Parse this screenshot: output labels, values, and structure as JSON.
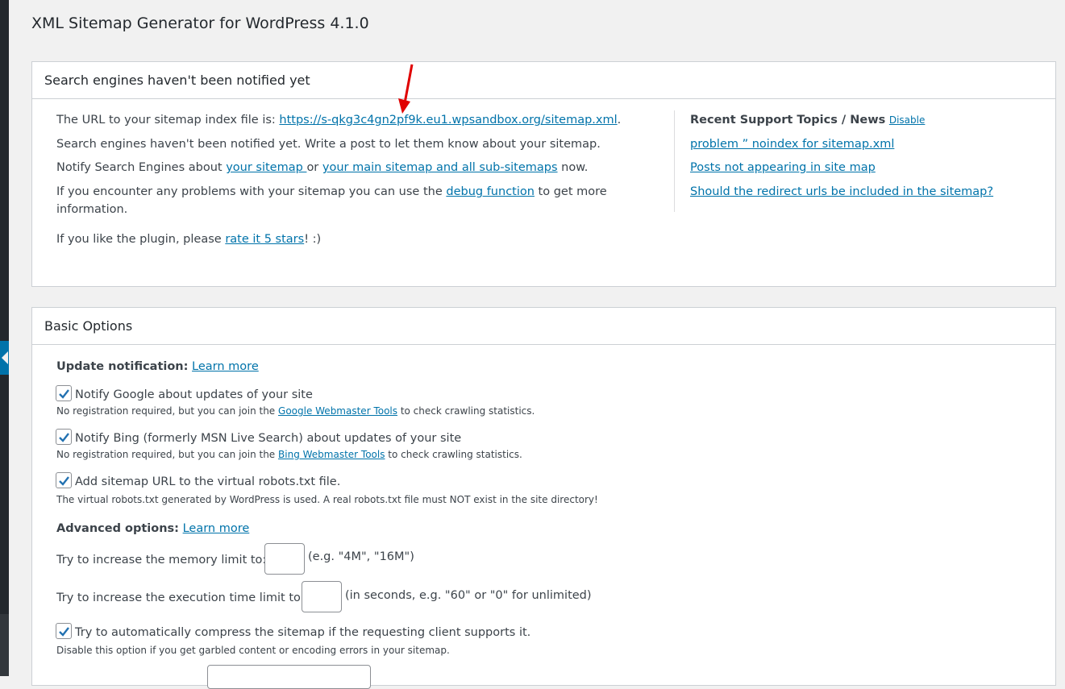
{
  "page": {
    "title": "XML Sitemap Generator for WordPress 4.1.0"
  },
  "status_box": {
    "title": "Search engines haven't been notified yet",
    "url_prefix": "The URL to your sitemap index file is: ",
    "url_link": "https://s-qkg3c4gn2pf9k.eu1.wpsandbox.org/sitemap.xml",
    "url_suffix": ".",
    "not_notified": "Search engines haven't been notified yet. Write a post to let them know about your sitemap.",
    "notify_prefix": "Notify Search Engines about ",
    "notify_link1": "your sitemap ",
    "notify_or": "or ",
    "notify_link2": "your main sitemap and all sub-sitemaps",
    "notify_suffix": " now.",
    "problems_prefix": "If you encounter any problems with your sitemap you can use the ",
    "problems_link": "debug function",
    "problems_suffix": " to get more",
    "problems_line2": "information.",
    "like_prefix": "If you like the plugin, please ",
    "like_link": "rate it 5 stars",
    "like_suffix": "! :)",
    "support": {
      "title": "Recent Support Topics / News",
      "disable_label": "Disable",
      "topics": [
        "problem ” noindex for sitemap.xml",
        "Posts not appearing in site map",
        "Should the redirect urls be included in the sitemap?"
      ]
    }
  },
  "basic_box": {
    "title": "Basic Options",
    "update_label": "Update notification:",
    "update_learn_more": "Learn more",
    "google_label": "Notify Google about updates of your site",
    "google_desc_prefix": "No registration required, but you can join the ",
    "google_desc_link": "Google Webmaster Tools",
    "google_desc_suffix": " to check crawling statistics.",
    "bing_label": "Notify Bing (formerly MSN Live Search) about updates of your site",
    "bing_desc_prefix": "No registration required, but you can join the ",
    "bing_desc_link": "Bing Webmaster Tools",
    "bing_desc_suffix": " to check crawling statistics.",
    "robots_label": "Add sitemap URL to the virtual robots.txt file.",
    "robots_desc": "The virtual robots.txt generated by WordPress is used. A real robots.txt file must NOT exist in the site directory!",
    "advanced_label": "Advanced options:",
    "advanced_learn_more": "Learn more",
    "memory_label": "Try to increase the memory limit to:",
    "memory_value": "",
    "memory_hint": "(e.g. \"4M\", \"16M\")",
    "time_label": "Try to increase the execution time limit to:",
    "time_value": "",
    "time_hint": "(in seconds, e.g. \"60\" or \"0\" for unlimited)",
    "compress_label": "Try to automatically compress the sitemap if the requesting client supports it.",
    "compress_desc": "Disable this option if you get garbled content or encoding errors in your sitemap."
  },
  "colors": {
    "link": "#0073aa",
    "annotation_arrow": "#e00000",
    "admin_bar": "#23282d"
  }
}
